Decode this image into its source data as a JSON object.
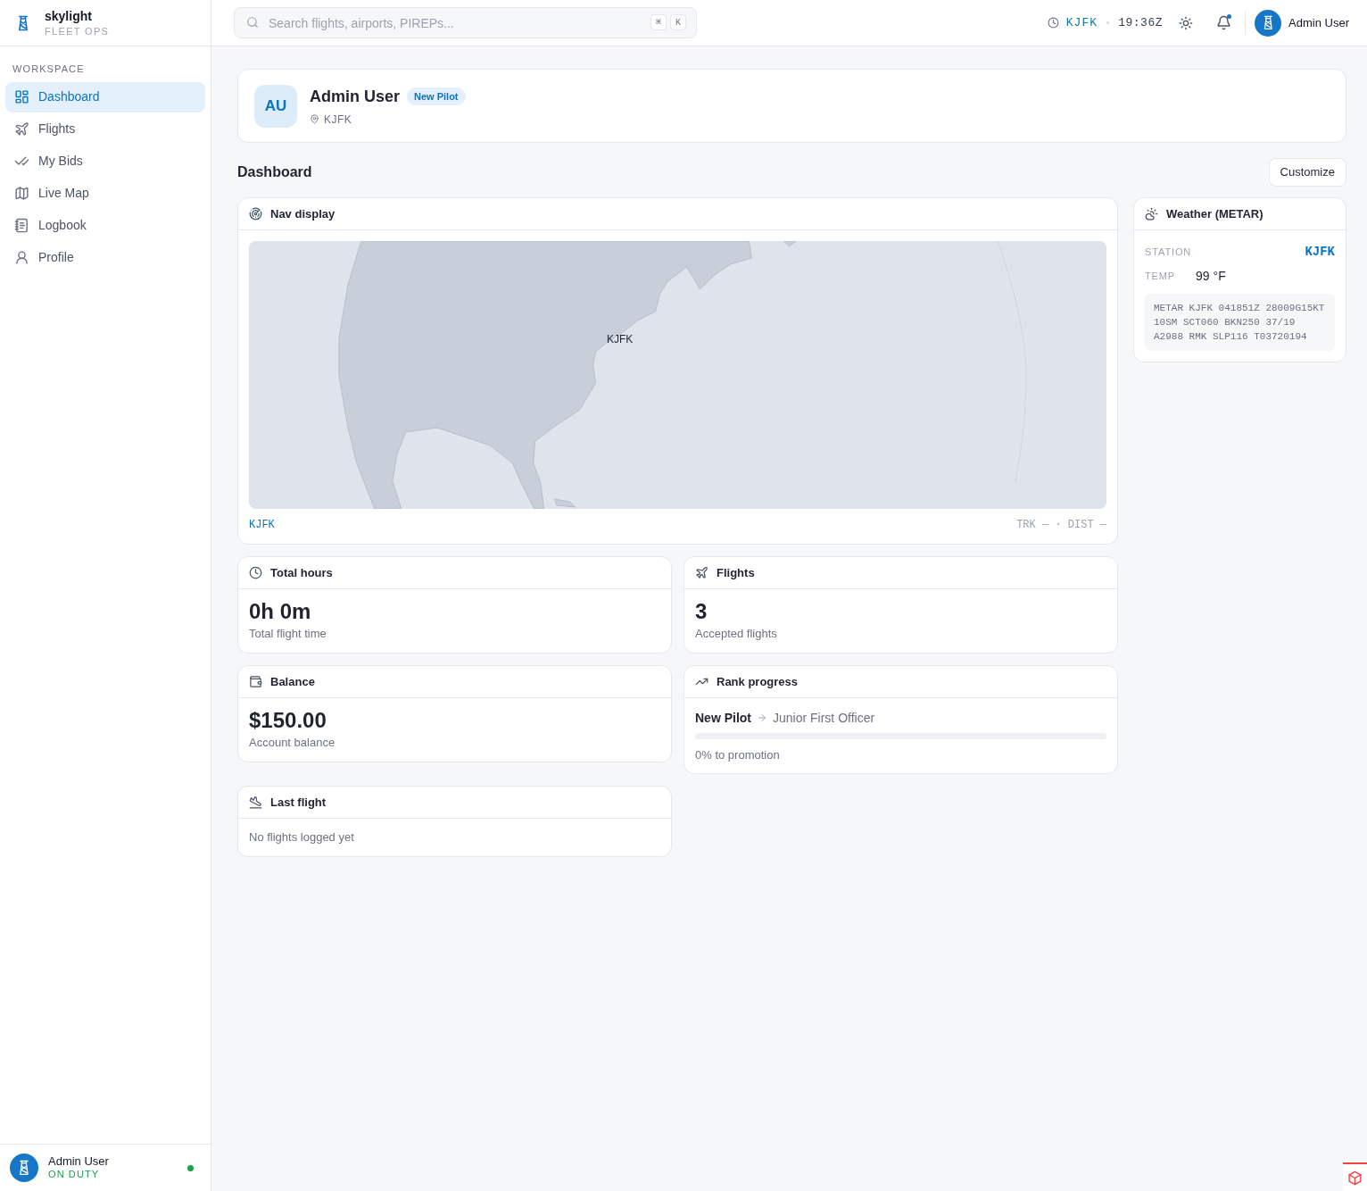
{
  "sidebar": {
    "brand": {
      "name": "skylight",
      "tagline": "FLEET OPS"
    },
    "section_label": "WORKSPACE",
    "items": [
      {
        "label": "Dashboard",
        "selected": true
      },
      {
        "label": "Flights",
        "selected": false
      },
      {
        "label": "My Bids",
        "selected": false
      },
      {
        "label": "Live Map",
        "selected": false
      },
      {
        "label": "Logbook",
        "selected": false
      },
      {
        "label": "Profile",
        "selected": false
      }
    ],
    "user": {
      "name": "Admin User",
      "status": "ON DUTY",
      "online": true
    }
  },
  "topbar": {
    "search": {
      "placeholder": "Search flights, airports, PIREPs...",
      "shortcut": [
        "⌘",
        "K"
      ]
    },
    "station": "KJFK",
    "time": "19:36Z",
    "unread_notifications": true,
    "user_name": "Admin User"
  },
  "profile": {
    "initials": "AU",
    "name": "Admin User",
    "rank_badge": "New Pilot",
    "location": "KJFK"
  },
  "dashboard": {
    "title": "Dashboard",
    "customize_button": "Customize"
  },
  "nav_display": {
    "title": "Nav display",
    "map_label": "KJFK",
    "station": "KJFK",
    "readout": "TRK — · DIST —"
  },
  "weather": {
    "title": "Weather (METAR)",
    "station_label": "STATION",
    "station": "KJFK",
    "temp_label": "TEMP",
    "temp": "99 °F",
    "metar": "METAR KJFK 041851Z 28009G15KT 10SM SCT060 BKN250 37/19 A2988 RMK SLP116 T03720194"
  },
  "widgets": [
    {
      "kind": "stat",
      "title": "Total hours",
      "value": "0h 0m",
      "caption": "Total flight time"
    },
    {
      "kind": "stat",
      "title": "Flights",
      "value": "3",
      "caption": "Accepted flights"
    },
    {
      "kind": "stat",
      "title": "Balance",
      "value": "$150.00",
      "caption": "Account balance"
    },
    {
      "kind": "progress",
      "title": "Rank progress",
      "current_rank": "New Pilot",
      "next_rank": "Junior First Officer",
      "level": 0,
      "caption": "0% to promotion"
    },
    {
      "kind": "empty",
      "title": "Last flight",
      "message": "No flights logged yet"
    }
  ]
}
